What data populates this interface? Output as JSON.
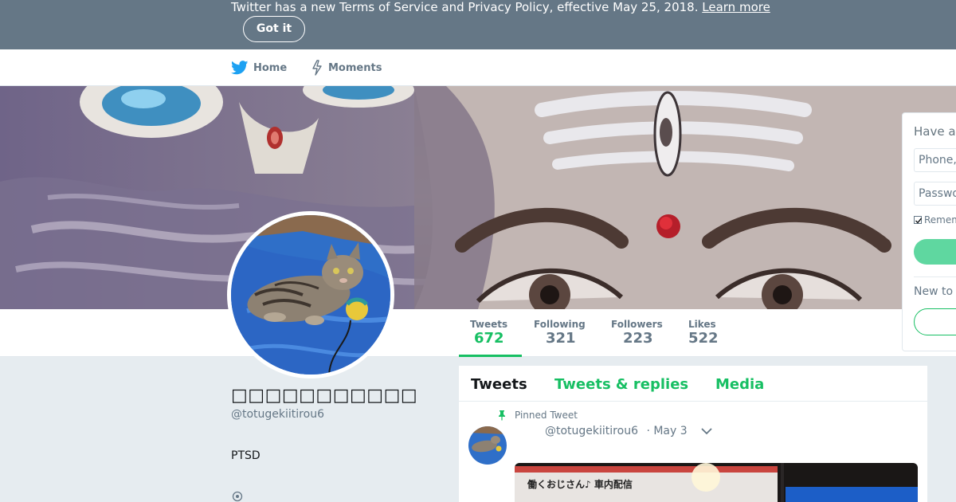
{
  "notice": {
    "text": "Twitter has a new Terms of Service and Privacy Policy, effective May 25, 2018.",
    "link": "Learn more",
    "button": "Got it"
  },
  "nav": {
    "home": "Home",
    "moments": "Moments"
  },
  "profile": {
    "fullname": "□□□□□□□□□□□",
    "handle": "@totugekiitirou6",
    "bio": "PTSD"
  },
  "stats": [
    {
      "label": "Tweets",
      "value": "672"
    },
    {
      "label": "Following",
      "value": "321"
    },
    {
      "label": "Followers",
      "value": "223"
    },
    {
      "label": "Likes",
      "value": "522"
    }
  ],
  "timeline": {
    "tabs": [
      "Tweets",
      "Tweets & replies",
      "Media"
    ],
    "pinned_label": "Pinned Tweet",
    "tweet_handle": "@totugekiitirou6",
    "tweet_date": "· May 3",
    "media_text": "働くおじさん♪ 車内配信"
  },
  "login": {
    "title": "Have an account?",
    "phone_placeholder": "Phone, email, or username",
    "password_placeholder": "Password",
    "remember": "Remember me",
    "new_to": "New to Twitter?"
  },
  "colors": {
    "accent": "#17bf63",
    "banner": "#657786",
    "twitter_blue": "#1da1f2"
  }
}
